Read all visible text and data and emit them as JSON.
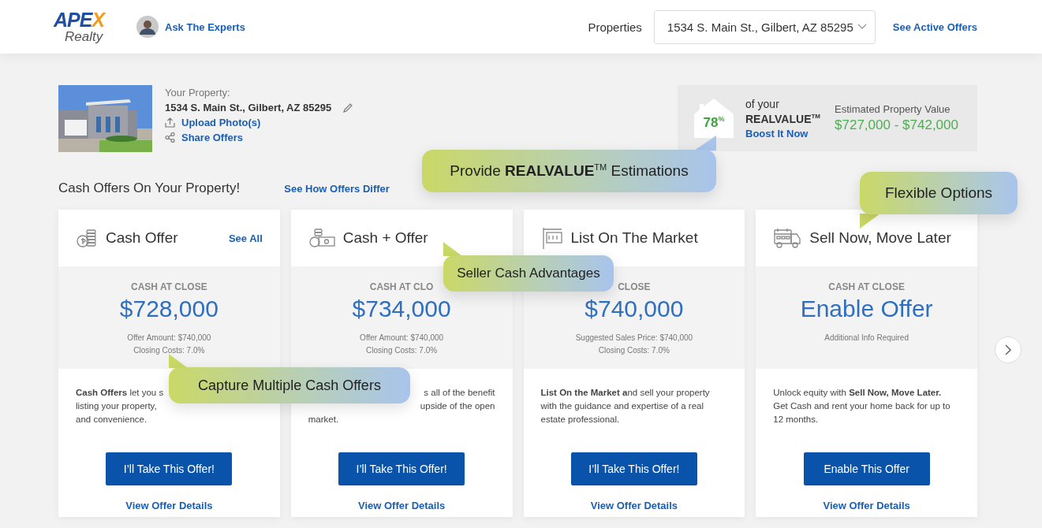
{
  "header": {
    "logo": {
      "word": "APEX",
      "sub": "Realty"
    },
    "experts_link": "Ask The Experts",
    "properties_label": "Properties",
    "property_select": {
      "value": "1534 S. Main St., Gilbert, AZ 85295"
    },
    "active_offers_link": "See Active Offers"
  },
  "property": {
    "label": "Your Property:",
    "address": "1534 S. Main St., Gilbert, AZ 85295",
    "upload_link": "Upload Photo(s)",
    "share_link": "Share Offers"
  },
  "realvalue": {
    "percent": "78$^{%}$",
    "of_your": "of your",
    "brand": "REALVALUE$^{TM}$",
    "boost_link": "Boost It Now",
    "estimate_label": "Estimated Property Value",
    "estimate": "$727,000 - $742,000"
  },
  "section": {
    "title": "Cash Offers On Your Property!",
    "link": "See How Offers Differ"
  },
  "cards": [
    {
      "kind": "coins",
      "title": "Cash Offer",
      "see_all": "See All",
      "cash_label": "CASH AT CLOSE",
      "amount": "$728,000",
      "details": [
        "Offer Amount: $740,000",
        "Closing Costs: 7.0%"
      ],
      "lines": [
        {
          "left": "**Cash Offers** let you s"
        },
        {
          "left": "listing your property,"
        },
        {
          "left": "and convenience."
        }
      ],
      "button": "I’ll Take This Offer!",
      "details_link": "View Offer Details"
    },
    {
      "kind": "cash",
      "title": "Cash + Offer",
      "cash_label": "CASH AT CLO",
      "amount": "$734,000",
      "details": [
        "Offer Amount: $740,000",
        "Closing Costs: 7.0%"
      ],
      "lines": [
        {
          "right": "s all of the benefit"
        },
        {
          "right": "upside of the open"
        },
        {
          "left": "market."
        }
      ],
      "button": "I’ll Take This Offer!",
      "details_link": "View Offer Details"
    },
    {
      "kind": "sign",
      "title": "List On The Market",
      "cash_label": "CLOSE",
      "amount": "$740,000",
      "details": [
        "Suggested Sales Price: $740,000",
        "Closing Costs: 7.0%"
      ],
      "lines": [
        {
          "left": "**List On the Market a**nd sell your property"
        },
        {
          "left": "with the guidance and expertise of a real"
        },
        {
          "left": "estate professional."
        }
      ],
      "button": "I’ll Take This Offer!",
      "details_link": "View Offer Details"
    },
    {
      "kind": "truck",
      "title": "Sell Now, Move Later",
      "cash_label": "CASH AT CLOSE",
      "amount": "Enable Offer",
      "details": [
        "Additional Info Required"
      ],
      "lines": [
        {
          "left": "Unlock equity with **Sell Now, Move Later.**"
        },
        {
          "left": "Get Cash and rent your home back for up to"
        },
        {
          "left": "12 months."
        }
      ],
      "button": "Enable This Offer",
      "details_link": "View Offer Details"
    }
  ],
  "callouts": [
    "Provide **REALVALUE**$^{TM}$ Estimations",
    "Flexible Options",
    "Seller Cash Advantages",
    "Capture Multiple Cash Offers"
  ]
}
